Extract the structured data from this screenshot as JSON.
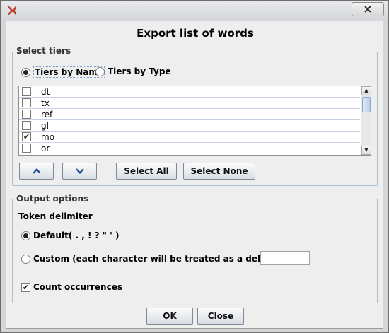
{
  "dialog": {
    "title": "Export list of words"
  },
  "select_tiers": {
    "label": "Select tiers",
    "mode_options": [
      {
        "label": "Tiers by Name",
        "selected": true
      },
      {
        "label": "Tiers by Type",
        "selected": false
      }
    ],
    "tiers": [
      {
        "name": "dt",
        "checked": false
      },
      {
        "name": "tx",
        "checked": false
      },
      {
        "name": "ref",
        "checked": false
      },
      {
        "name": "gl",
        "checked": false
      },
      {
        "name": "mo",
        "checked": true
      },
      {
        "name": "or",
        "checked": false
      }
    ],
    "move_up_icon": "double-chevron-up-icon",
    "move_down_icon": "double-chevron-down-icon",
    "select_all_label": "Select All",
    "select_none_label": "Select None"
  },
  "output_options": {
    "label": "Output options",
    "token_delimiter_label": "Token delimiter",
    "default_option_label": "Default( . , ! ? \" ' )",
    "default_selected": true,
    "custom_option_label": "Custom (each character will be treated as a delimiter)",
    "custom_value": "",
    "count_occurrences_label": "Count occurrences",
    "count_occurrences_checked": true
  },
  "footer": {
    "ok_label": "OK",
    "close_label": "Close"
  },
  "colors": {
    "group_border": "#a9bfd6",
    "client_background": "#eeeeee",
    "app_icon": "#c0392b"
  }
}
